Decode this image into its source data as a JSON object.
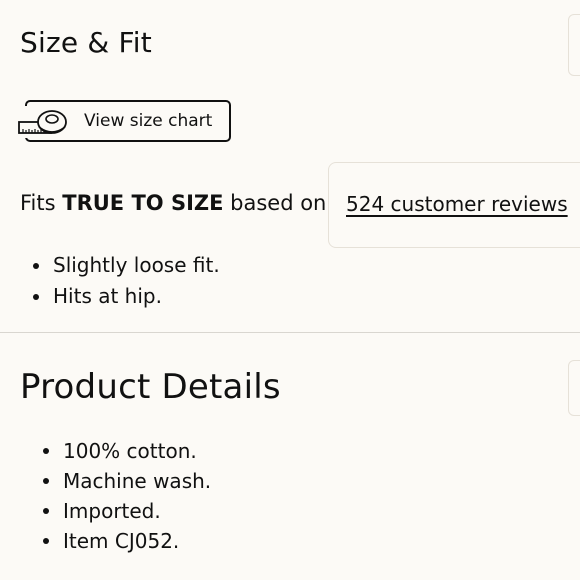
{
  "size_fit": {
    "title": "Size & Fit",
    "size_chart_button": {
      "label": "View size chart",
      "icon": "measuring-tape-icon"
    },
    "fit_prefix": "Fits",
    "fit_value": "TRUE TO SIZE",
    "fit_suffix": "based on",
    "reviews_link": "524 customer reviews",
    "fit_notes": [
      "Slightly loose fit.",
      "Hits at hip."
    ]
  },
  "product_details": {
    "title": "Product Details",
    "items": [
      "100% cotton.",
      "Machine wash.",
      "Imported.",
      "Item CJ052."
    ]
  }
}
